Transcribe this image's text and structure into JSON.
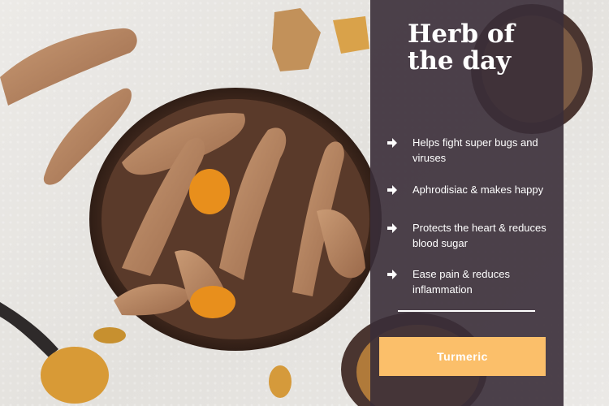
{
  "panel": {
    "title": "Herb of the day",
    "benefits": [
      {
        "text": "Helps fight super bugs and viruses",
        "icon": "arrow-right-icon"
      },
      {
        "text": "Aphrodisiac & makes happy",
        "icon": "arrow-right-icon"
      },
      {
        "text": "Protects the heart & reduces blood sugar",
        "icon": "arrow-right-icon"
      },
      {
        "text": "Ease pain & reduces inflammation",
        "icon": "arrow-right-icon"
      }
    ]
  },
  "cta": {
    "label": "Turmeric"
  },
  "colors": {
    "panel": "#3a2e38",
    "accent": "#fbbf6a",
    "text": "#ffffff"
  }
}
